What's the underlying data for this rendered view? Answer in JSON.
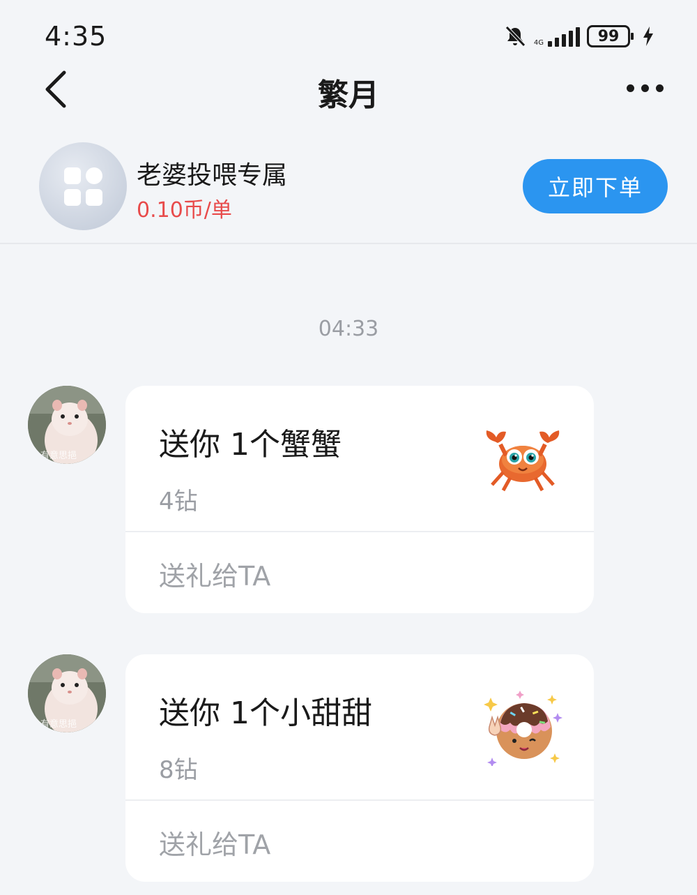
{
  "status_bar": {
    "time": "4:35",
    "network_label": "4G",
    "battery_level": "99"
  },
  "header": {
    "title": "繁月",
    "back_icon": "chevron-left-icon",
    "more_icon": "more-horizontal-icon"
  },
  "service": {
    "name": "老婆投喂专属",
    "price": "0.10币/单",
    "price_color": "#e84b4b",
    "order_button_label": "立即下单",
    "accent_color": "#2b95f0"
  },
  "chat": {
    "timestamp": "04:33",
    "avatar_watermark": "有意思挹",
    "messages": [
      {
        "title": "送你 1个蟹蟹",
        "price": "4钻",
        "action_label": "送礼给TA",
        "gift_icon": "crab-gift-icon"
      },
      {
        "title": "送你 1个小甜甜",
        "price": "8钻",
        "action_label": "送礼给TA",
        "gift_icon": "donut-gift-icon"
      }
    ]
  }
}
